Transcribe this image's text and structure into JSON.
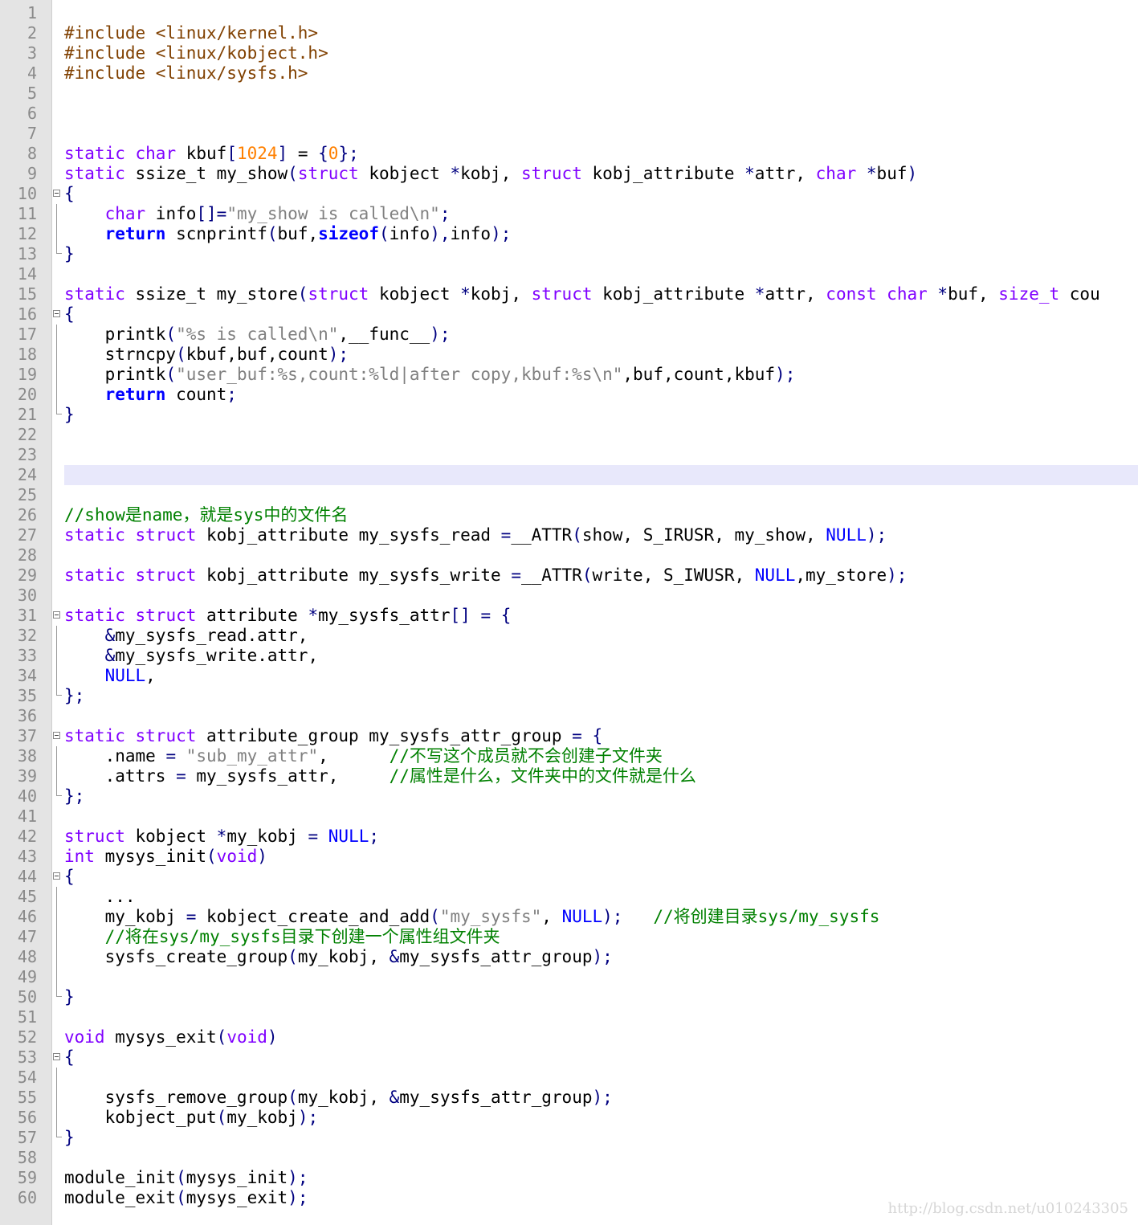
{
  "editor": {
    "lines": [
      {
        "n": "1",
        "tokens": [],
        "fold": "none"
      },
      {
        "n": "2",
        "tokens": [
          {
            "t": "#include <linux/kernel.h>",
            "c": "pp"
          }
        ],
        "fold": "none"
      },
      {
        "n": "3",
        "tokens": [
          {
            "t": "#include <linux/kobject.h>",
            "c": "pp"
          }
        ],
        "fold": "none"
      },
      {
        "n": "4",
        "tokens": [
          {
            "t": "#include <linux/sysfs.h>",
            "c": "pp"
          }
        ],
        "fold": "none"
      },
      {
        "n": "5",
        "tokens": [],
        "fold": "none"
      },
      {
        "n": "6",
        "tokens": [],
        "fold": "none"
      },
      {
        "n": "7",
        "tokens": [],
        "fold": "none"
      },
      {
        "n": "8",
        "tokens": [
          {
            "t": "static",
            "c": "kw"
          },
          {
            "t": " "
          },
          {
            "t": "char",
            "c": "kw"
          },
          {
            "t": " kbuf"
          },
          {
            "t": "[",
            "c": "op"
          },
          {
            "t": "1024",
            "c": "nm"
          },
          {
            "t": "]",
            "c": "op"
          },
          {
            "t": " = "
          },
          {
            "t": "{",
            "c": "op"
          },
          {
            "t": "0",
            "c": "nm"
          },
          {
            "t": "};",
            "c": "op"
          }
        ],
        "fold": "none"
      },
      {
        "n": "9",
        "tokens": [
          {
            "t": "static",
            "c": "kw"
          },
          {
            "t": " ssize_t my_show"
          },
          {
            "t": "(",
            "c": "op"
          },
          {
            "t": "struct",
            "c": "kw"
          },
          {
            "t": " kobject "
          },
          {
            "t": "*",
            "c": "op"
          },
          {
            "t": "kobj, "
          },
          {
            "t": "struct",
            "c": "kw"
          },
          {
            "t": " kobj_attribute "
          },
          {
            "t": "*",
            "c": "op"
          },
          {
            "t": "attr, "
          },
          {
            "t": "char",
            "c": "kw"
          },
          {
            "t": " "
          },
          {
            "t": "*",
            "c": "op"
          },
          {
            "t": "buf"
          },
          {
            "t": ")",
            "c": "op"
          }
        ],
        "fold": "none"
      },
      {
        "n": "10",
        "tokens": [
          {
            "t": "{",
            "c": "op"
          }
        ],
        "fold": "start"
      },
      {
        "n": "11",
        "tokens": [
          {
            "t": "    "
          },
          {
            "t": "char",
            "c": "kw"
          },
          {
            "t": " info"
          },
          {
            "t": "[]=",
            "c": "op"
          },
          {
            "t": "\"my_show is called\\n\"",
            "c": "st"
          },
          {
            "t": ";",
            "c": "op"
          }
        ],
        "fold": "line"
      },
      {
        "n": "12",
        "tokens": [
          {
            "t": "    "
          },
          {
            "t": "return",
            "c": "kb"
          },
          {
            "t": " scnprintf"
          },
          {
            "t": "(",
            "c": "op"
          },
          {
            "t": "buf,"
          },
          {
            "t": "sizeof",
            "c": "kb"
          },
          {
            "t": "(",
            "c": "op"
          },
          {
            "t": "info"
          },
          {
            "t": "),",
            "c": "op"
          },
          {
            "t": "info"
          },
          {
            "t": ");",
            "c": "op"
          }
        ],
        "fold": "line"
      },
      {
        "n": "13",
        "tokens": [
          {
            "t": "}",
            "c": "op"
          }
        ],
        "fold": "end"
      },
      {
        "n": "14",
        "tokens": [],
        "fold": "none"
      },
      {
        "n": "15",
        "tokens": [
          {
            "t": "static",
            "c": "kw"
          },
          {
            "t": " ssize_t my_store"
          },
          {
            "t": "(",
            "c": "op"
          },
          {
            "t": "struct",
            "c": "kw"
          },
          {
            "t": " kobject "
          },
          {
            "t": "*",
            "c": "op"
          },
          {
            "t": "kobj, "
          },
          {
            "t": "struct",
            "c": "kw"
          },
          {
            "t": " kobj_attribute "
          },
          {
            "t": "*",
            "c": "op"
          },
          {
            "t": "attr, "
          },
          {
            "t": "const",
            "c": "kw"
          },
          {
            "t": " "
          },
          {
            "t": "char",
            "c": "kw"
          },
          {
            "t": " "
          },
          {
            "t": "*",
            "c": "op"
          },
          {
            "t": "buf, "
          },
          {
            "t": "size_t",
            "c": "kw"
          },
          {
            "t": " cou"
          }
        ],
        "fold": "none"
      },
      {
        "n": "16",
        "tokens": [
          {
            "t": "{",
            "c": "op"
          }
        ],
        "fold": "start"
      },
      {
        "n": "17",
        "tokens": [
          {
            "t": "    printk"
          },
          {
            "t": "(",
            "c": "op"
          },
          {
            "t": "\"%s is called\\n\"",
            "c": "st"
          },
          {
            "t": ",__func__"
          },
          {
            "t": ");",
            "c": "op"
          }
        ],
        "fold": "line"
      },
      {
        "n": "18",
        "tokens": [
          {
            "t": "    strncpy"
          },
          {
            "t": "(",
            "c": "op"
          },
          {
            "t": "kbuf,buf,count"
          },
          {
            "t": ");",
            "c": "op"
          }
        ],
        "fold": "line"
      },
      {
        "n": "19",
        "tokens": [
          {
            "t": "    printk"
          },
          {
            "t": "(",
            "c": "op"
          },
          {
            "t": "\"user_buf:%s,count:%ld|after copy,kbuf:%s\\n\"",
            "c": "st"
          },
          {
            "t": ",buf,count,kbuf"
          },
          {
            "t": ");",
            "c": "op"
          }
        ],
        "fold": "line"
      },
      {
        "n": "20",
        "tokens": [
          {
            "t": "    "
          },
          {
            "t": "return",
            "c": "kb"
          },
          {
            "t": " count"
          },
          {
            "t": ";",
            "c": "op"
          }
        ],
        "fold": "line"
      },
      {
        "n": "21",
        "tokens": [
          {
            "t": "}",
            "c": "op"
          }
        ],
        "fold": "end"
      },
      {
        "n": "22",
        "tokens": [],
        "fold": "none"
      },
      {
        "n": "23",
        "tokens": [],
        "fold": "none"
      },
      {
        "n": "24",
        "tokens": [],
        "fold": "none",
        "highlight": true
      },
      {
        "n": "25",
        "tokens": [],
        "fold": "none"
      },
      {
        "n": "26",
        "tokens": [
          {
            "t": "//show是name，就是sys中的文件名",
            "c": "cm"
          }
        ],
        "fold": "none"
      },
      {
        "n": "27",
        "tokens": [
          {
            "t": "static",
            "c": "kw"
          },
          {
            "t": " "
          },
          {
            "t": "struct",
            "c": "kw"
          },
          {
            "t": " kobj_attribute my_sysfs_read "
          },
          {
            "t": "=",
            "c": "op"
          },
          {
            "t": "__ATTR"
          },
          {
            "t": "(",
            "c": "op"
          },
          {
            "t": "show, S_IRUSR, my_show, "
          },
          {
            "t": "NULL",
            "c": "cn"
          },
          {
            "t": ");",
            "c": "op"
          }
        ],
        "fold": "none"
      },
      {
        "n": "28",
        "tokens": [],
        "fold": "none"
      },
      {
        "n": "29",
        "tokens": [
          {
            "t": "static",
            "c": "kw"
          },
          {
            "t": " "
          },
          {
            "t": "struct",
            "c": "kw"
          },
          {
            "t": " kobj_attribute my_sysfs_write "
          },
          {
            "t": "=",
            "c": "op"
          },
          {
            "t": "__ATTR"
          },
          {
            "t": "(",
            "c": "op"
          },
          {
            "t": "write, S_IWUSR, "
          },
          {
            "t": "NULL",
            "c": "cn"
          },
          {
            "t": ",my_store"
          },
          {
            "t": ");",
            "c": "op"
          }
        ],
        "fold": "none"
      },
      {
        "n": "30",
        "tokens": [],
        "fold": "none"
      },
      {
        "n": "31",
        "tokens": [
          {
            "t": "static",
            "c": "kw"
          },
          {
            "t": " "
          },
          {
            "t": "struct",
            "c": "kw"
          },
          {
            "t": " attribute "
          },
          {
            "t": "*",
            "c": "op"
          },
          {
            "t": "my_sysfs_attr"
          },
          {
            "t": "[]",
            "c": "op"
          },
          {
            "t": " "
          },
          {
            "t": "=",
            "c": "op"
          },
          {
            "t": " "
          },
          {
            "t": "{",
            "c": "op"
          }
        ],
        "fold": "start"
      },
      {
        "n": "32",
        "tokens": [
          {
            "t": "    "
          },
          {
            "t": "&",
            "c": "op"
          },
          {
            "t": "my_sysfs_read.attr,"
          }
        ],
        "fold": "line"
      },
      {
        "n": "33",
        "tokens": [
          {
            "t": "    "
          },
          {
            "t": "&",
            "c": "op"
          },
          {
            "t": "my_sysfs_write.attr,"
          }
        ],
        "fold": "line"
      },
      {
        "n": "34",
        "tokens": [
          {
            "t": "    "
          },
          {
            "t": "NULL",
            "c": "cn"
          },
          {
            "t": ","
          }
        ],
        "fold": "line"
      },
      {
        "n": "35",
        "tokens": [
          {
            "t": "};",
            "c": "op"
          }
        ],
        "fold": "end"
      },
      {
        "n": "36",
        "tokens": [],
        "fold": "none"
      },
      {
        "n": "37",
        "tokens": [
          {
            "t": "static",
            "c": "kw"
          },
          {
            "t": " "
          },
          {
            "t": "struct",
            "c": "kw"
          },
          {
            "t": " attribute_group my_sysfs_attr_group "
          },
          {
            "t": "=",
            "c": "op"
          },
          {
            "t": " "
          },
          {
            "t": "{",
            "c": "op"
          }
        ],
        "fold": "start"
      },
      {
        "n": "38",
        "tokens": [
          {
            "t": "    .name "
          },
          {
            "t": "=",
            "c": "op"
          },
          {
            "t": " "
          },
          {
            "t": "\"sub_my_attr\"",
            "c": "st"
          },
          {
            "t": ",      "
          },
          {
            "t": "//不写这个成员就不会创建子文件夹",
            "c": "cm"
          }
        ],
        "fold": "line"
      },
      {
        "n": "39",
        "tokens": [
          {
            "t": "    .attrs "
          },
          {
            "t": "=",
            "c": "op"
          },
          {
            "t": " my_sysfs_attr,     "
          },
          {
            "t": "//属性是什么，文件夹中的文件就是什么",
            "c": "cm"
          }
        ],
        "fold": "line"
      },
      {
        "n": "40",
        "tokens": [
          {
            "t": "};",
            "c": "op"
          }
        ],
        "fold": "end"
      },
      {
        "n": "41",
        "tokens": [],
        "fold": "none"
      },
      {
        "n": "42",
        "tokens": [
          {
            "t": "struct",
            "c": "kw"
          },
          {
            "t": " kobject "
          },
          {
            "t": "*",
            "c": "op"
          },
          {
            "t": "my_kobj "
          },
          {
            "t": "=",
            "c": "op"
          },
          {
            "t": " "
          },
          {
            "t": "NULL",
            "c": "cn"
          },
          {
            "t": ";",
            "c": "op"
          }
        ],
        "fold": "none"
      },
      {
        "n": "43",
        "tokens": [
          {
            "t": "int",
            "c": "kw"
          },
          {
            "t": " mysys_init"
          },
          {
            "t": "(",
            "c": "op"
          },
          {
            "t": "void",
            "c": "kw"
          },
          {
            "t": ")",
            "c": "op"
          }
        ],
        "fold": "none"
      },
      {
        "n": "44",
        "tokens": [
          {
            "t": "{",
            "c": "op"
          }
        ],
        "fold": "start"
      },
      {
        "n": "45",
        "tokens": [
          {
            "t": "    ..."
          }
        ],
        "fold": "line"
      },
      {
        "n": "46",
        "tokens": [
          {
            "t": "    my_kobj "
          },
          {
            "t": "=",
            "c": "op"
          },
          {
            "t": " kobject_create_and_add"
          },
          {
            "t": "(",
            "c": "op"
          },
          {
            "t": "\"my_sysfs\"",
            "c": "st"
          },
          {
            "t": ", "
          },
          {
            "t": "NULL",
            "c": "cn"
          },
          {
            "t": ");",
            "c": "op"
          },
          {
            "t": "   "
          },
          {
            "t": "//将创建目录sys/my_sysfs",
            "c": "cm"
          }
        ],
        "fold": "line"
      },
      {
        "n": "47",
        "tokens": [
          {
            "t": "    "
          },
          {
            "t": "//将在sys/my_sysfs目录下创建一个属性组文件夹",
            "c": "cm"
          }
        ],
        "fold": "line"
      },
      {
        "n": "48",
        "tokens": [
          {
            "t": "    sysfs_create_group"
          },
          {
            "t": "(",
            "c": "op"
          },
          {
            "t": "my_kobj, "
          },
          {
            "t": "&",
            "c": "op"
          },
          {
            "t": "my_sysfs_attr_group"
          },
          {
            "t": ");",
            "c": "op"
          }
        ],
        "fold": "line"
      },
      {
        "n": "49",
        "tokens": [],
        "fold": "line"
      },
      {
        "n": "50",
        "tokens": [
          {
            "t": "}",
            "c": "op"
          }
        ],
        "fold": "end"
      },
      {
        "n": "51",
        "tokens": [],
        "fold": "none"
      },
      {
        "n": "52",
        "tokens": [
          {
            "t": "void",
            "c": "kw"
          },
          {
            "t": " mysys_exit"
          },
          {
            "t": "(",
            "c": "op"
          },
          {
            "t": "void",
            "c": "kw"
          },
          {
            "t": ")",
            "c": "op"
          }
        ],
        "fold": "none"
      },
      {
        "n": "53",
        "tokens": [
          {
            "t": "{",
            "c": "op"
          }
        ],
        "fold": "start"
      },
      {
        "n": "54",
        "tokens": [],
        "fold": "line"
      },
      {
        "n": "55",
        "tokens": [
          {
            "t": "    sysfs_remove_group"
          },
          {
            "t": "(",
            "c": "op"
          },
          {
            "t": "my_kobj, "
          },
          {
            "t": "&",
            "c": "op"
          },
          {
            "t": "my_sysfs_attr_group"
          },
          {
            "t": ");",
            "c": "op"
          }
        ],
        "fold": "line"
      },
      {
        "n": "56",
        "tokens": [
          {
            "t": "    kobject_put"
          },
          {
            "t": "(",
            "c": "op"
          },
          {
            "t": "my_kobj"
          },
          {
            "t": ");",
            "c": "op"
          }
        ],
        "fold": "line"
      },
      {
        "n": "57",
        "tokens": [
          {
            "t": "}",
            "c": "op"
          }
        ],
        "fold": "end"
      },
      {
        "n": "58",
        "tokens": [],
        "fold": "none"
      },
      {
        "n": "59",
        "tokens": [
          {
            "t": "module_init"
          },
          {
            "t": "(",
            "c": "op"
          },
          {
            "t": "mysys_init"
          },
          {
            "t": ");",
            "c": "op"
          }
        ],
        "fold": "none"
      },
      {
        "n": "60",
        "tokens": [
          {
            "t": "module_exit"
          },
          {
            "t": "(",
            "c": "op"
          },
          {
            "t": "mysys_exit"
          },
          {
            "t": ");",
            "c": "op"
          }
        ],
        "fold": "none"
      }
    ]
  },
  "watermark": "http://blog.csdn.net/u010243305"
}
